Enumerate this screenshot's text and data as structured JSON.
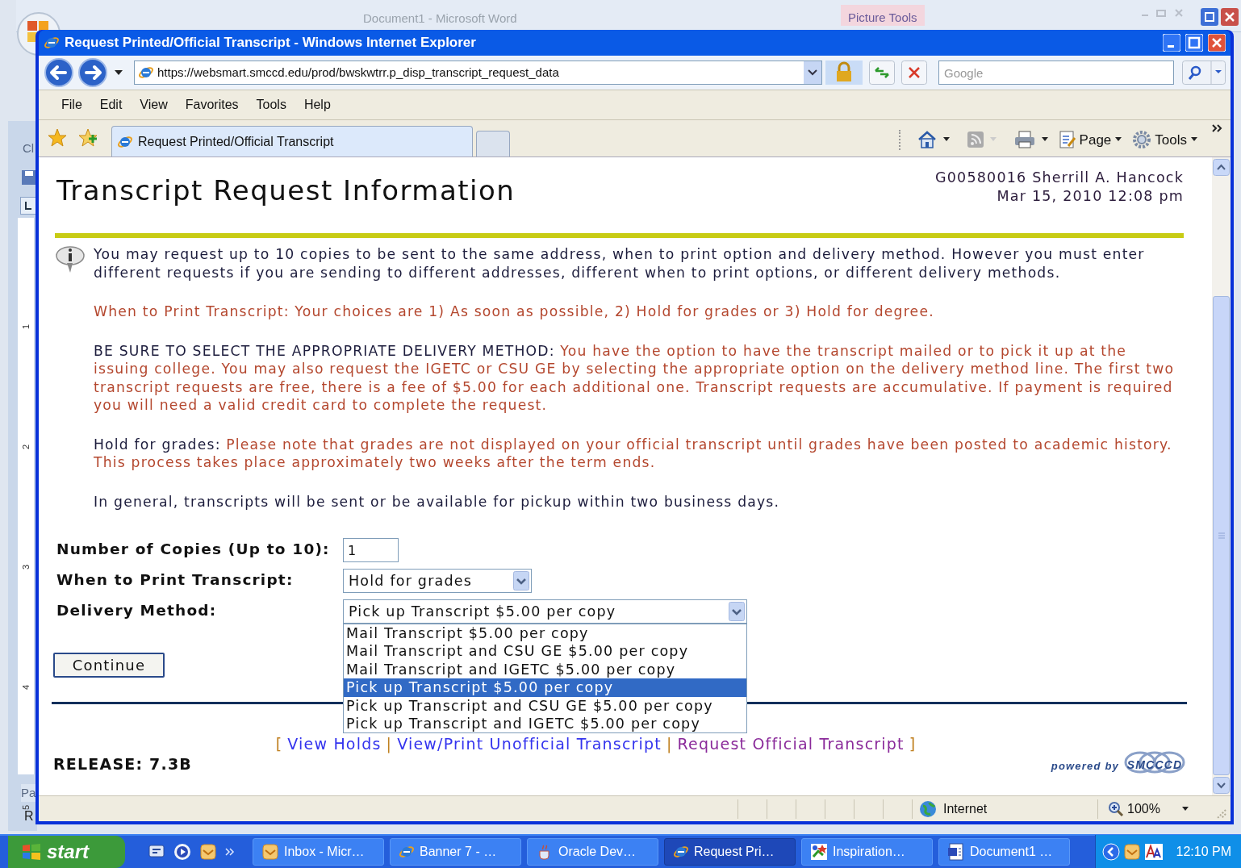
{
  "word_window": {
    "title": "Document1 - Microsoft Word",
    "context_tab": "Picture Tools",
    "ruler_numbers": [
      "1",
      "2",
      "3",
      "4",
      "5"
    ],
    "fragment_top": "Cl",
    "fragment_bottom": [
      "Pa",
      "R"
    ]
  },
  "browser": {
    "title": "Request Printed/Official Transcript - Windows Internet Explorer",
    "address": "https://websmart.smccd.edu/prod/bwskwtrr.p_disp_transcript_request_data",
    "search_placeholder": "Google",
    "menu": [
      "File",
      "Edit",
      "View",
      "Favorites",
      "Tools",
      "Help"
    ],
    "tabs": [
      {
        "label": "Request Printed/Official Transcript",
        "selected": true
      }
    ],
    "command_buttons": [
      "Page",
      "Tools"
    ],
    "status": {
      "zone": "Internet",
      "zoom": "100%"
    }
  },
  "page": {
    "title": "Transcript Request Information",
    "user": "G00580016 Sherrill A. Hancock",
    "datetime": "Mar 15, 2010 12:08 pm",
    "info": "You may request up to 10 copies to be sent to the same address, when to print option and delivery method. However you must enter different requests if you are sending to different addresses, different when to print options, or different delivery methods.",
    "paragraphs": [
      {
        "kind": "warning",
        "text": "When to Print Transcript: Your choices are 1) As soon as possible, 2) Hold for grades or 3) Hold for degree."
      },
      {
        "kind": "warning",
        "label": "BE SURE TO SELECT THE APPROPRIATE DELIVERY METHOD:",
        "text": "You have the option to have the transcript mailed or to pick it up at the issuing college. You may also request the IGETC or CSU GE by selecting the appropriate option on the delivery method line. The first two transcript requests are free, there is a fee of $5.00 for each additional one. Transcript requests are accumulative. If payment is required you will need a valid credit card to complete the request."
      },
      {
        "kind": "warning",
        "label": "Hold for grades:",
        "text": "Please note that grades are not displayed on your official transcript until grades have been posted to academic history. This process takes place approximately two weeks after the term ends."
      },
      {
        "kind": "plain",
        "text": "In general, transcripts will be sent or be available for pickup within two business days."
      }
    ],
    "form": {
      "copies_label": "Number of Copies (Up to 10):",
      "copies": "1",
      "when_label": "When to Print Transcript:",
      "when": "Hold for grades",
      "delivery_label": "Delivery Method:",
      "delivery": "Pick up Transcript $5.00 per copy",
      "delivery_expanded": true,
      "delivery_options": [
        {
          "label": "Mail Transcript $5.00 per copy",
          "selected": false
        },
        {
          "label": "Mail Transcript and CSU GE $5.00 per copy",
          "selected": false
        },
        {
          "label": "Mail Transcript and IGETC $5.00 per copy",
          "selected": false
        },
        {
          "label": "Pick up Transcript $5.00 per copy",
          "selected": true
        },
        {
          "label": "Pick up Transcript and CSU GE $5.00 per copy",
          "selected": false
        },
        {
          "label": "Pick up Transcript and IGETC $5.00 per copy",
          "selected": false
        }
      ],
      "submit": "Continue"
    },
    "links_open": "[",
    "links_close": "]",
    "links_separator": "|",
    "links": [
      {
        "label": "View Holds",
        "visited": false
      },
      {
        "label": "View/Print Unofficial Transcript",
        "visited": false
      },
      {
        "label": "Request Official Transcript",
        "visited": true
      }
    ],
    "release": "RELEASE: 7.3B",
    "powered_by": "powered by",
    "logo_text": "SMCCCD"
  },
  "taskbar": {
    "start": "start",
    "tasks": [
      {
        "label": "Inbox - Micr…",
        "kind": "mail",
        "selected": false
      },
      {
        "label": "Banner 7 - …",
        "kind": "browser",
        "selected": false
      },
      {
        "label": "Oracle Dev…",
        "kind": "cup",
        "selected": false
      },
      {
        "label": "Request Pri…",
        "kind": "browser",
        "selected": true
      },
      {
        "label": "Inspiration…",
        "kind": "map",
        "selected": false
      },
      {
        "label": "Document1 …",
        "kind": "doc",
        "selected": false
      }
    ],
    "clock": "12:10 PM"
  }
}
